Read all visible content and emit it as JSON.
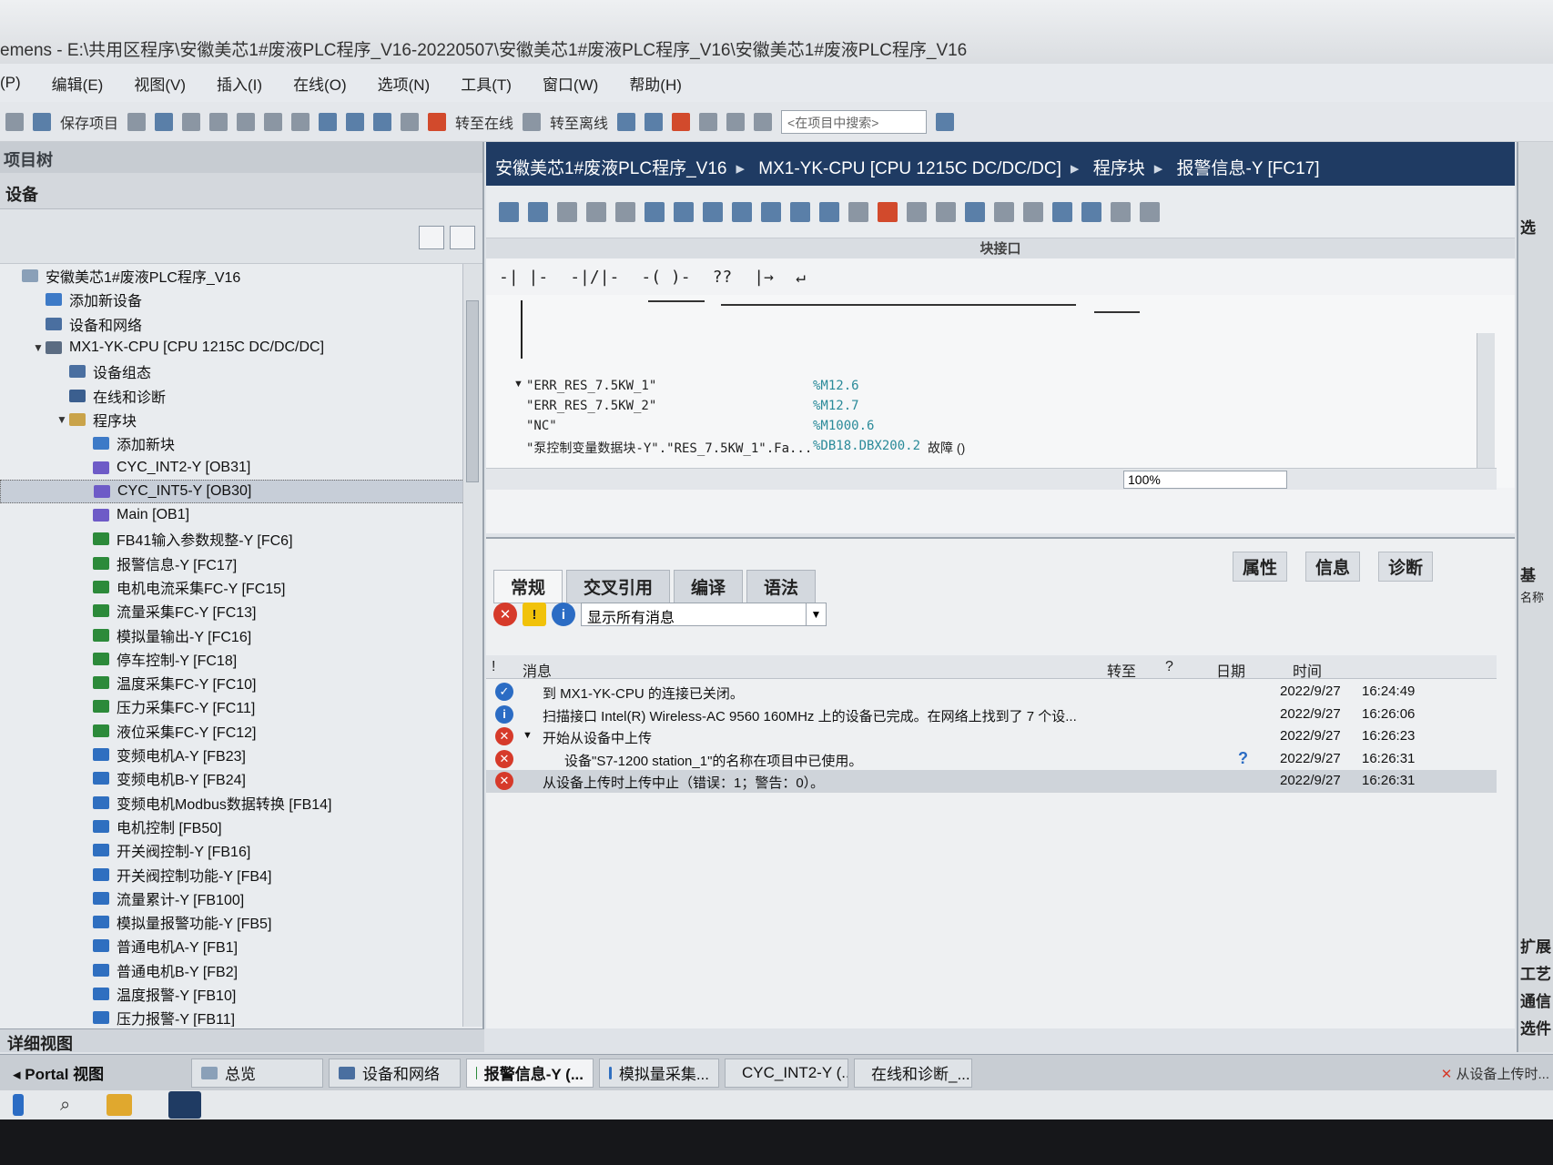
{
  "window": {
    "title": "emens  -  E:\\共用区程序\\安徽美芯1#废液PLC程序_V16-20220507\\安徽美芯1#废液PLC程序_V16\\安徽美芯1#废液PLC程序_V16"
  },
  "menu": {
    "items": [
      "(P)",
      "编辑(E)",
      "视图(V)",
      "插入(I)",
      "在线(O)",
      "选项(N)",
      "工具(T)",
      "窗口(W)",
      "帮助(H)"
    ]
  },
  "toolbar": {
    "save_label": "保存项目",
    "go_online_label": "转至在线",
    "go_offline_label": "转至离线",
    "search_placeholder": "<在项目中搜索>"
  },
  "project_tree": {
    "header": "项目树",
    "tab": "设备",
    "items": [
      {
        "label": "安徽美芯1#废液PLC程序_V16",
        "icon": "project-icon",
        "level": 0
      },
      {
        "label": "添加新设备",
        "icon": "add-device-icon",
        "level": 1
      },
      {
        "label": "设备和网络",
        "icon": "network-icon",
        "level": 1
      },
      {
        "label": "MX1-YK-CPU [CPU 1215C DC/DC/DC]",
        "icon": "cpu-icon",
        "level": 1
      },
      {
        "label": "设备组态",
        "icon": "device-config-icon",
        "level": 2
      },
      {
        "label": "在线和诊断",
        "icon": "diagnostics-icon",
        "level": 2
      },
      {
        "label": "程序块",
        "icon": "folder-icon",
        "level": 2
      },
      {
        "label": "添加新块",
        "icon": "add-block-icon",
        "level": 3
      },
      {
        "label": "CYC_INT2-Y [OB31]",
        "icon": "ob-icon",
        "level": 3
      },
      {
        "label": "CYC_INT5-Y [OB30]",
        "icon": "ob-icon",
        "level": 3
      },
      {
        "label": "Main [OB1]",
        "icon": "ob-icon",
        "level": 3
      },
      {
        "label": "FB41输入参数规整-Y [FC6]",
        "icon": "fc-icon",
        "level": 3
      },
      {
        "label": "报警信息-Y [FC17]",
        "icon": "fc-icon",
        "level": 3
      },
      {
        "label": "电机电流采集FC-Y [FC15]",
        "icon": "fc-icon",
        "level": 3
      },
      {
        "label": "流量采集FC-Y [FC13]",
        "icon": "fc-icon",
        "level": 3
      },
      {
        "label": "模拟量输出-Y [FC16]",
        "icon": "fc-icon",
        "level": 3
      },
      {
        "label": "停车控制-Y [FC18]",
        "icon": "fc-icon",
        "level": 3
      },
      {
        "label": "温度采集FC-Y [FC10]",
        "icon": "fc-icon",
        "level": 3
      },
      {
        "label": "压力采集FC-Y [FC11]",
        "icon": "fc-icon",
        "level": 3
      },
      {
        "label": "液位采集FC-Y [FC12]",
        "icon": "fc-icon",
        "level": 3
      },
      {
        "label": "变频电机A-Y [FB23]",
        "icon": "fb-icon",
        "level": 3
      },
      {
        "label": "变频电机B-Y [FB24]",
        "icon": "fb-icon",
        "level": 3
      },
      {
        "label": "变频电机Modbus数据转换 [FB14]",
        "icon": "fb-icon",
        "level": 3
      },
      {
        "label": "电机控制 [FB50]",
        "icon": "fb-icon",
        "level": 3
      },
      {
        "label": "开关阀控制-Y [FB16]",
        "icon": "fb-icon",
        "level": 3
      },
      {
        "label": "开关阀控制功能-Y [FB4]",
        "icon": "fb-icon",
        "level": 3
      },
      {
        "label": "流量累计-Y [FB100]",
        "icon": "fb-icon",
        "level": 3
      },
      {
        "label": "模拟量报警功能-Y [FB5]",
        "icon": "fb-icon",
        "level": 3
      },
      {
        "label": "普通电机A-Y [FB1]",
        "icon": "fb-icon",
        "level": 3
      },
      {
        "label": "普通电机B-Y [FB2]",
        "icon": "fb-icon",
        "level": 3
      },
      {
        "label": "温度报警-Y [FB10]",
        "icon": "fb-icon",
        "level": 3
      },
      {
        "label": "压力报警-Y [FB11]",
        "icon": "fb-icon",
        "level": 3
      }
    ],
    "selected_index": 9,
    "detail_view": "详细视图"
  },
  "editor": {
    "breadcrumb": [
      "安徽美芯1#废液PLC程序_V16",
      "MX1-YK-CPU [CPU 1215C DC/DC/DC]",
      "程序块",
      "报警信息-Y [FC17]"
    ],
    "block_interface": "块接口",
    "lad_elements": [
      "-| |-",
      "-|/|-",
      "-( )-",
      "??",
      "|→",
      "↵"
    ],
    "operands": [
      {
        "name": "\"ERR_RES_7.5KW_1\"",
        "address": "%M12.6",
        "comment": ""
      },
      {
        "name": "\"ERR_RES_7.5KW_2\"",
        "address": "%M12.7",
        "comment": ""
      },
      {
        "name": "\"NC\"",
        "address": "%M1000.6",
        "comment": ""
      },
      {
        "name": "\"泵控制变量数据块-Y\".\"RES_7.5KW_1\".Fa...",
        "address": "%DB18.DBX200.2",
        "comment": "故障 ()"
      }
    ],
    "zoom": "100%"
  },
  "inspector": {
    "right_tabs": [
      "属性",
      "信息",
      "诊断"
    ],
    "tabs": [
      "常规",
      "交叉引用",
      "编译",
      "语法"
    ],
    "filter": "显示所有消息",
    "columns": {
      "flag": "!",
      "message": "消息",
      "goto": "转至",
      "help": "?",
      "date": "日期",
      "time": "时间"
    },
    "messages": [
      {
        "type": "ok",
        "text": "到 MX1-YK-CPU 的连接已关闭。",
        "date": "2022/9/27",
        "time": "16:24:49",
        "indent": 0,
        "help": ""
      },
      {
        "type": "info",
        "text": "扫描接口 Intel(R) Wireless-AC 9560 160MHz 上的设备已完成。在网络上找到了 7 个设...",
        "date": "2022/9/27",
        "time": "16:26:06",
        "indent": 0,
        "help": ""
      },
      {
        "type": "err",
        "text": "开始从设备中上传",
        "date": "2022/9/27",
        "time": "16:26:23",
        "indent": 0,
        "help": ""
      },
      {
        "type": "err",
        "text": "设备\"S7-1200 station_1\"的名称在项目中已使用。",
        "date": "2022/9/27",
        "time": "16:26:31",
        "indent": 1,
        "help": "?"
      },
      {
        "type": "err",
        "text": "从设备上传时上传中止（错误：1；警告：0）。",
        "date": "2022/9/27",
        "time": "16:26:31",
        "indent": 0,
        "help": ""
      }
    ]
  },
  "right_panel": {
    "items": [
      "选",
      "基",
      "名称",
      "扩展",
      "工艺",
      "通信",
      "选件"
    ]
  },
  "statusbar": {
    "portal": "Portal 视图",
    "tabs": [
      {
        "label": "总览",
        "icon": "overview-icon"
      },
      {
        "label": "设备和网络",
        "icon": "network-icon"
      },
      {
        "label": "报警信息-Y (...",
        "icon": "fc-icon"
      },
      {
        "label": "模拟量采集...",
        "icon": "fb-icon"
      },
      {
        "label": "CYC_INT2-Y (...",
        "icon": "ob-icon"
      },
      {
        "label": "在线和诊断_...",
        "icon": "diagnostics-icon"
      }
    ],
    "active_tab": 2,
    "message": "从设备上传时..."
  },
  "colors": {
    "breadcrumb_bg": "#1f3b63",
    "error": "#d63a2a",
    "info": "#2b6cc4",
    "fc_green": "#2c8a3a",
    "address_teal": "#2a8a99"
  }
}
